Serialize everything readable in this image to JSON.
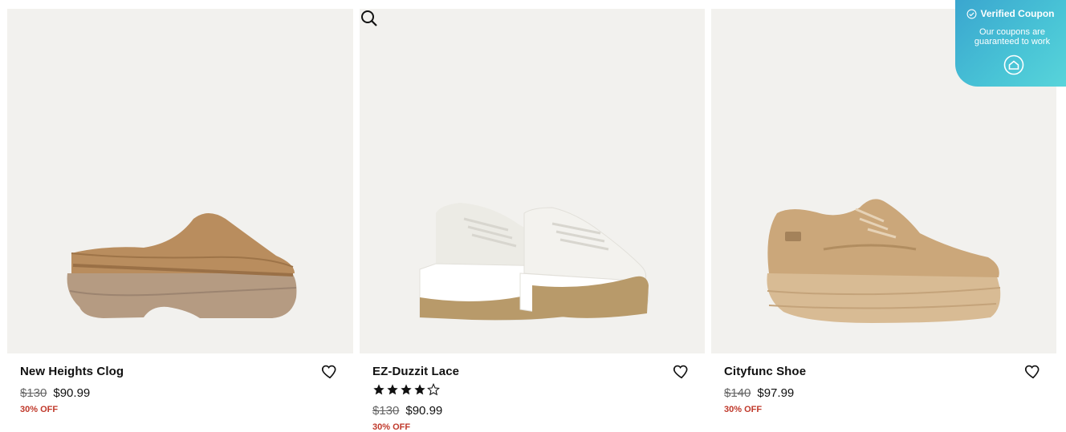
{
  "products": [
    {
      "name": "New Heights Clog",
      "old_price": "$130",
      "new_price": "$90.99",
      "discount": "30% OFF",
      "rating": null
    },
    {
      "name": "EZ-Duzzit Lace",
      "old_price": "$130",
      "new_price": "$90.99",
      "discount": "30% OFF",
      "rating": 4
    },
    {
      "name": "Cityfunc Shoe",
      "old_price": "$140",
      "new_price": "$97.99",
      "discount": "30% OFF",
      "rating": null
    }
  ],
  "coupon": {
    "title": "Verified Coupon",
    "subtitle": "Our coupons are guaranteed to work"
  },
  "colors": {
    "discount": "#c0392b",
    "image_bg": "#f2f1ee",
    "coupon_bg": "#49c4d6"
  },
  "icons": {
    "heart": "heart-icon",
    "zoom": "search-icon",
    "star": "star-icon",
    "home": "home-icon",
    "check": "check-circle-icon"
  }
}
